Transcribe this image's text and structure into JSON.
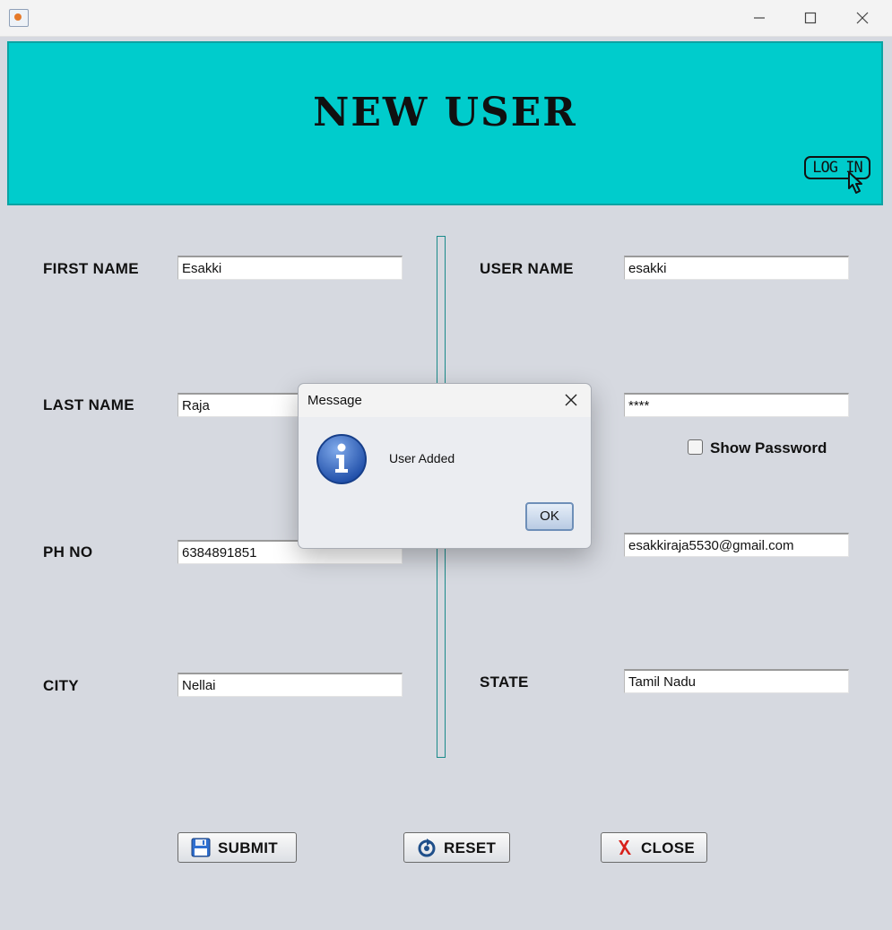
{
  "window": {
    "icon": "java-cup-icon",
    "controls": {
      "minimize": "minimize-icon",
      "maximize": "maximize-icon",
      "close": "close-icon"
    }
  },
  "banner": {
    "title": "NEW USER",
    "login_label": "LOG IN",
    "background": "#00cccc"
  },
  "form": {
    "first_name": {
      "label": "FIRST NAME",
      "value": "Esakki"
    },
    "last_name": {
      "label": "LAST NAME",
      "value": "Raja"
    },
    "phone": {
      "label": "PH NO",
      "value": "6384891851"
    },
    "city": {
      "label": "CITY",
      "value": "Nellai"
    },
    "user_name": {
      "label": "USER NAME",
      "value": "esakki"
    },
    "password": {
      "value": "****",
      "show_label": "Show Password"
    },
    "email": {
      "value": "esakkiraja5530@gmail.com"
    },
    "state": {
      "label": "STATE",
      "value": "Tamil Nadu"
    }
  },
  "buttons": {
    "submit": "SUBMIT",
    "reset": "RESET",
    "close": "CLOSE"
  },
  "dialog": {
    "title": "Message",
    "message": "User Added",
    "ok": "OK",
    "icon": "info-icon"
  }
}
